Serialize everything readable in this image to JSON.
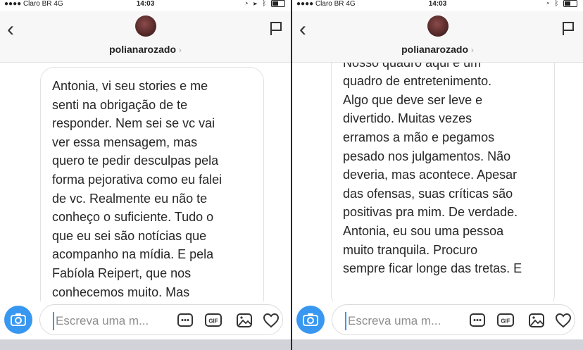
{
  "panels": [
    {
      "status": {
        "carrier": "Claro BR",
        "network": "4G",
        "time": "14:03"
      },
      "header": {
        "username": "polianarozado"
      },
      "message": "Antonia, vi seu stories e me\nsenti na obrigação de te\nresponder. Nem sei se vc vai\nver essa mensagem, mas\nquero te pedir desculpas pela\nforma pejorativa como eu falei\nde vc. Realmente eu não te\nconheço o suficiente. Tudo o\nque eu sei são notícias que\nacompanho na mídia. E pela\nFabíola Reipert, que nos\nconhecemos muito. Mas",
      "composer": {
        "placeholder": "Escreva uma m..."
      }
    },
    {
      "status": {
        "carrier": "Claro BR",
        "network": "4G",
        "time": "14:03"
      },
      "header": {
        "username": "polianarozado"
      },
      "message": "Fabíola fala muito bem de vc.\nNosso quadro aqui é um\nquadro de entretenimento.\nAlgo que deve ser leve e\ndivertido. Muitas vezes\nerramos a mão e pegamos\npesado nos julgamentos. Não\ndeveria, mas acontece. Apesar\ndas ofensas, suas críticas são\npositivas pra mim. De verdade.\nAntonia, eu sou uma pessoa\nmuito tranquila. Procuro\nsempre ficar longe das tretas. E",
      "composer": {
        "placeholder": "Escreva uma m..."
      }
    }
  ],
  "icons": [
    "back-icon",
    "flag-icon",
    "camera-icon",
    "more-icon",
    "gif-icon",
    "gallery-icon",
    "heart-icon"
  ],
  "colors": {
    "accent": "#3897f0",
    "text": "#262626",
    "header_bg": "#f7f7f7",
    "bubble_border": "#e2e2e2"
  }
}
